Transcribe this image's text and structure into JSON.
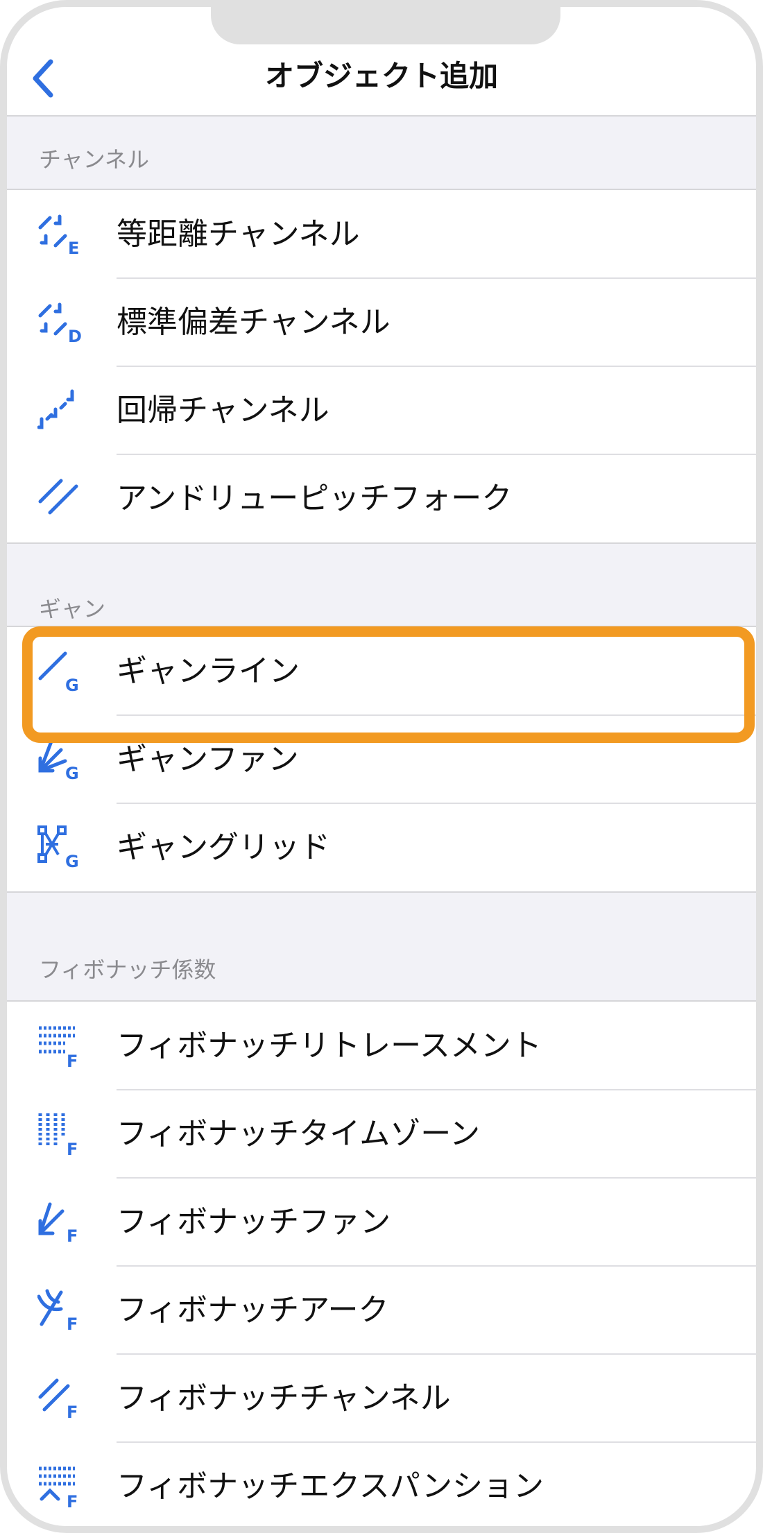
{
  "header": {
    "title": "オブジェクト追加",
    "back_icon": "chevron-left-icon"
  },
  "colors": {
    "accent": "#2f6fe0",
    "highlight": "#f29a22",
    "background": "#f2f2f7"
  },
  "sections": [
    {
      "header": "チャンネル",
      "items": [
        {
          "label": "等距離チャンネル",
          "icon": "equidistant-channel-icon"
        },
        {
          "label": "標準偏差チャンネル",
          "icon": "stddev-channel-icon"
        },
        {
          "label": "回帰チャンネル",
          "icon": "regression-channel-icon"
        },
        {
          "label": "アンドリューピッチフォーク",
          "icon": "andrews-pitchfork-icon"
        }
      ]
    },
    {
      "header": "ギャン",
      "items": [
        {
          "label": "ギャンライン",
          "icon": "gann-line-icon",
          "highlighted": true
        },
        {
          "label": "ギャンファン",
          "icon": "gann-fan-icon"
        },
        {
          "label": "ギャングリッド",
          "icon": "gann-grid-icon"
        }
      ]
    },
    {
      "header": "フィボナッチ係数",
      "items": [
        {
          "label": "フィボナッチリトレースメント",
          "icon": "fibo-retracement-icon"
        },
        {
          "label": "フィボナッチタイムゾーン",
          "icon": "fibo-timezones-icon"
        },
        {
          "label": "フィボナッチファン",
          "icon": "fibo-fan-icon"
        },
        {
          "label": "フィボナッチアーク",
          "icon": "fibo-arc-icon"
        },
        {
          "label": "フィボナッチチャンネル",
          "icon": "fibo-channel-icon"
        },
        {
          "label": "フィボナッチエクスパンション",
          "icon": "fibo-expansion-icon"
        }
      ]
    }
  ]
}
